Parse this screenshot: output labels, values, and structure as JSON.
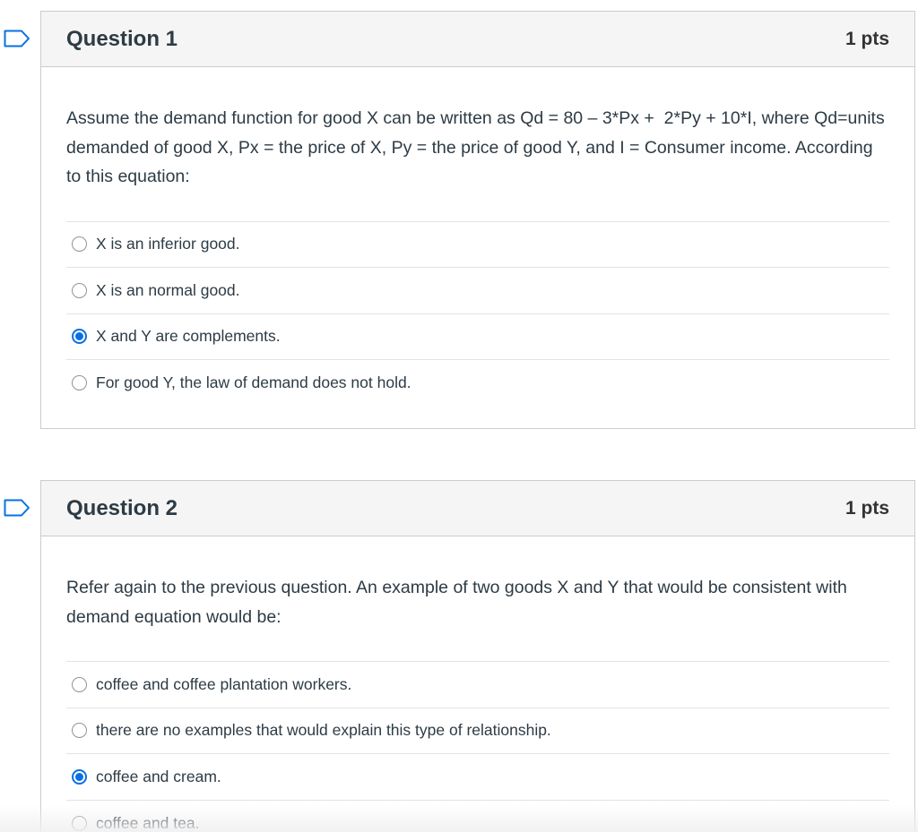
{
  "questions": [
    {
      "title": "Question 1",
      "points": "1 pts",
      "text": "Assume the demand function for good X can be written as Qd = 80 – 3*Px +  2*Py + 10*I, where Qd=units demanded of good X, Px = the price of X, Py = the price of good Y, and I = Consumer income. According to this equation:",
      "answers": [
        {
          "label": "X is an inferior good.",
          "selected": false
        },
        {
          "label": "X is an normal good.",
          "selected": false
        },
        {
          "label": "X and Y are complements.",
          "selected": true
        },
        {
          "label": "For good Y, the law of demand does not hold.",
          "selected": false
        }
      ]
    },
    {
      "title": "Question 2",
      "points": "1 pts",
      "text": "Refer again to the previous question. An example of two goods X and Y that would be consistent with demand equation would be:",
      "answers": [
        {
          "label": "coffee and coffee plantation workers.",
          "selected": false
        },
        {
          "label": "there are no examples that would explain this type of relationship.",
          "selected": false
        },
        {
          "label": "coffee and cream.",
          "selected": true
        },
        {
          "label": "coffee and tea.",
          "selected": false
        }
      ]
    }
  ],
  "icons": {
    "flag": "flag-icon",
    "radio": "radio-button"
  },
  "colors": {
    "accent": "#0770e3",
    "border": "#c7cdd1",
    "header_bg": "#f5f5f5"
  }
}
